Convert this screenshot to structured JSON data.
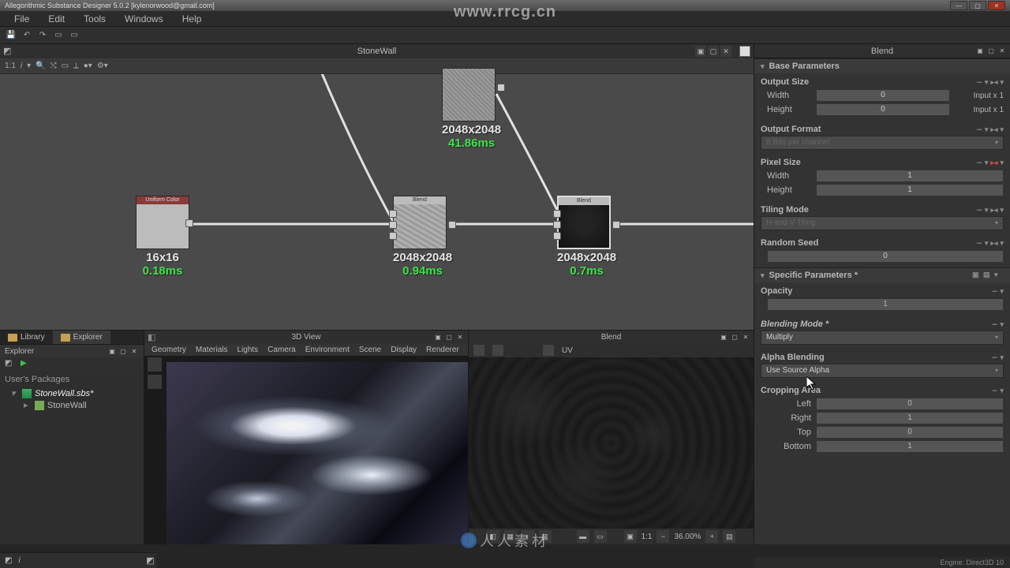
{
  "titlebar": {
    "title": "Allegorithmic Substance Designer 5.0.2 [kylenorwood@gmail.com]"
  },
  "menubar": [
    "File",
    "Edit",
    "Tools",
    "Windows",
    "Help"
  ],
  "watermark": "www.rrcg.cn",
  "graph": {
    "title": "StoneWall",
    "zoom": "1:1",
    "nodes": {
      "top": {
        "name": "",
        "dims": "2048x2048",
        "time": "41.86ms"
      },
      "uniform": {
        "name": "Uniform Color",
        "dims": "16x16",
        "time": "0.18ms"
      },
      "blend1": {
        "name": "Blend",
        "dims": "2048x2048",
        "time": "0.94ms"
      },
      "blend2": {
        "name": "Blend",
        "dims": "2048x2048",
        "time": "0.7ms"
      }
    }
  },
  "explorer": {
    "tabs": {
      "library": "Library",
      "explorer": "Explorer"
    },
    "title": "Explorer",
    "section": "User's Packages",
    "items": {
      "pkg": "StoneWall.sbs*",
      "graph": "StoneWall"
    }
  },
  "view3d": {
    "title": "3D View",
    "menus": [
      "Geometry",
      "Materials",
      "Lights",
      "Camera",
      "Environment",
      "Scene",
      "Display",
      "Renderer"
    ]
  },
  "blendview": {
    "title": "Blend",
    "uv": "UV",
    "zoom": "1:1",
    "percent": "36.00%"
  },
  "props": {
    "header": "Blend",
    "base": {
      "title": "Base Parameters",
      "output_size": {
        "label": "Output Size",
        "width_lbl": "Width",
        "width_val": "0",
        "width_ext": "Input x 1",
        "height_lbl": "Height",
        "height_val": "0",
        "height_ext": "Input x 1"
      },
      "output_format": {
        "label": "Output Format",
        "val": "8 Bits per channel"
      },
      "pixel_size": {
        "label": "Pixel Size",
        "width_lbl": "Width",
        "width_val": "1",
        "height_lbl": "Height",
        "height_val": "1"
      },
      "tiling": {
        "label": "Tiling Mode",
        "val": "H and V Tiling"
      },
      "seed": {
        "label": "Random Seed",
        "val": "0"
      }
    },
    "specific": {
      "title": "Specific Parameters *",
      "opacity": {
        "label": "Opacity",
        "val": "1"
      },
      "blending": {
        "label": "Blending Mode *",
        "val": "Multiply"
      },
      "alpha": {
        "label": "Alpha Blending",
        "val": "Use Source Alpha"
      },
      "crop": {
        "label": "Cropping Area",
        "left_lbl": "Left",
        "left": "0",
        "right_lbl": "Right",
        "right": "1",
        "top_lbl": "Top",
        "top": "0",
        "bottom_lbl": "Bottom",
        "bottom": "1"
      }
    }
  },
  "status": {
    "engine": "Engine: Direct3D 10"
  }
}
